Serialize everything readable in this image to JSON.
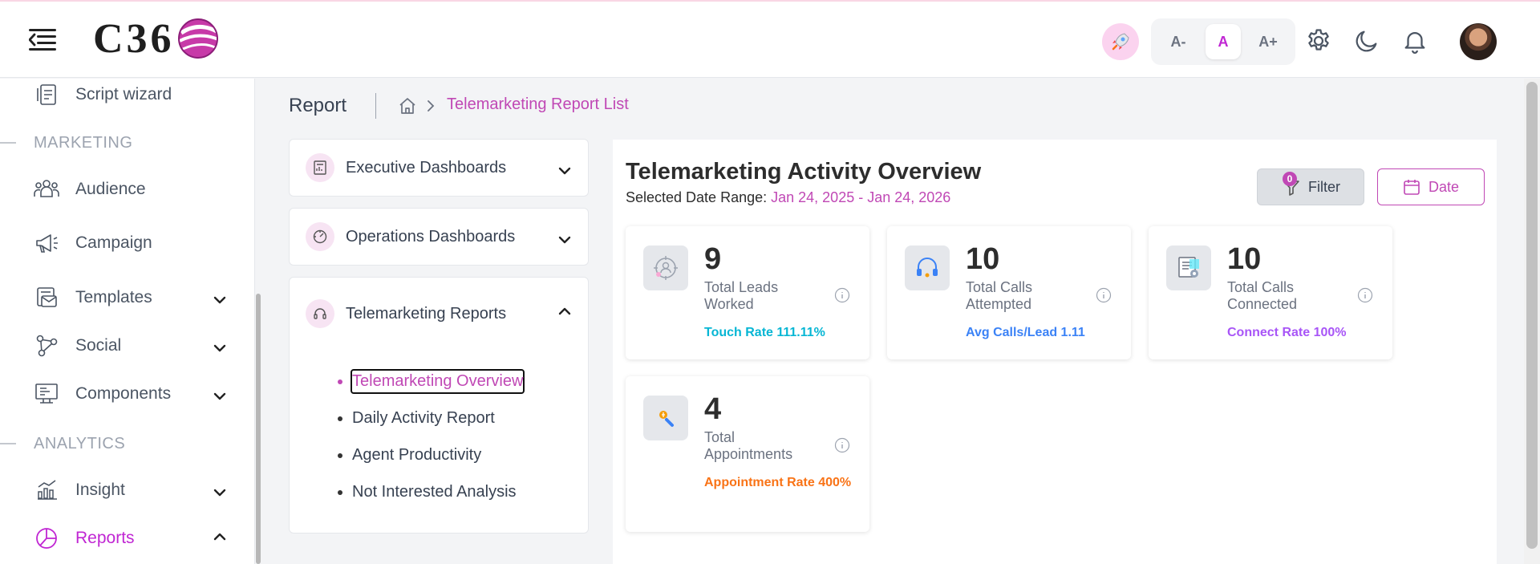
{
  "header": {
    "logo_text": "C36",
    "font_small": "A-",
    "font_normal": "A",
    "font_large": "A+"
  },
  "sidebar": {
    "items": [
      {
        "label": "Script wizard"
      },
      {
        "label": "Audience"
      },
      {
        "label": "Campaign"
      },
      {
        "label": "Templates"
      },
      {
        "label": "Social"
      },
      {
        "label": "Components"
      },
      {
        "label": "Insight"
      },
      {
        "label": "Reports"
      }
    ],
    "sections": {
      "marketing": "MARKETING",
      "analytics": "ANALYTICS"
    }
  },
  "main": {
    "page_title": "Report",
    "breadcrumb": "Telemarketing Report List",
    "accordions": [
      {
        "label": "Executive Dashboards"
      },
      {
        "label": "Operations Dashboards"
      },
      {
        "label": "Telemarketing Reports"
      }
    ],
    "report_links": [
      {
        "label": "Telemarketing Overview"
      },
      {
        "label": "Daily Activity Report"
      },
      {
        "label": "Agent Productivity"
      },
      {
        "label": "Not Interested Analysis"
      }
    ]
  },
  "panel": {
    "title": "Telemarketing Activity Overview",
    "range_label": "Selected Date Range: ",
    "range_value": "Jan 24, 2025 - Jan 24, 2026",
    "filter_label": "Filter",
    "filter_count": "0",
    "date_label": "Date",
    "stats": [
      {
        "value": "9",
        "label": "Total Leads Worked",
        "sub": "Touch Rate 111.11%",
        "color": "#06b6d4"
      },
      {
        "value": "10",
        "label": "Total Calls Attempted",
        "sub": "Avg Calls/Lead 1.11",
        "color": "#3b82f6"
      },
      {
        "value": "10",
        "label": "Total Calls Connected",
        "sub": "Connect Rate 100%",
        "color": "#a855f7"
      },
      {
        "value": "4",
        "label": "Total Appointments",
        "sub": "Appointment Rate 400%",
        "color": "#f97316"
      }
    ]
  },
  "colors": {
    "accent": "#c048b5",
    "text": "#374151",
    "muted": "#6b7280"
  }
}
